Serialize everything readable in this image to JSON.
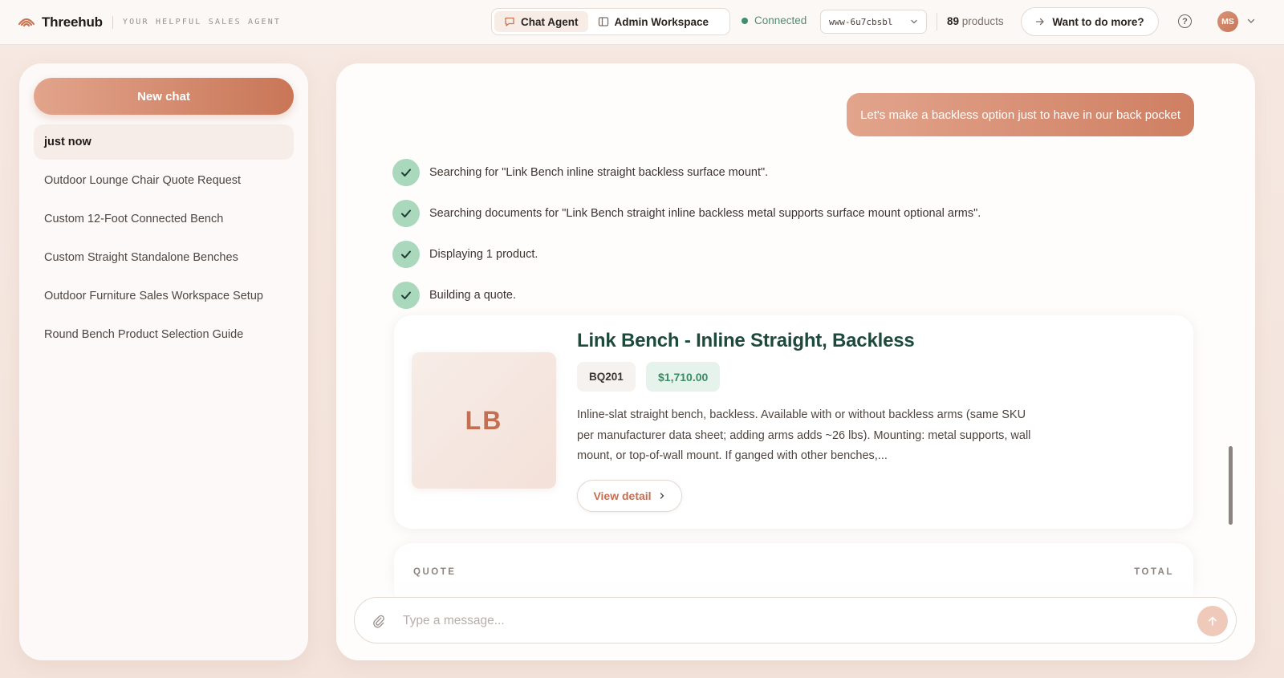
{
  "header": {
    "app_name": "Threehub",
    "tagline": "YOUR HELPFUL SALES AGENT",
    "modes": [
      {
        "label": "Chat Agent",
        "icon": "chat-bubble-icon",
        "active": true
      },
      {
        "label": "Admin Workspace",
        "icon": "sidebar-panel-icon",
        "active": false
      }
    ],
    "connection_status": "Connected",
    "environment": "www-6u7cbsbl",
    "product_count": "89",
    "product_count_suffix": "products",
    "more_button": "Want to do more?",
    "help_glyph": "?",
    "user_initials": "MS",
    "accent_color": "#c97657"
  },
  "sidebar": {
    "new_chat_label": "New chat",
    "chats": [
      {
        "label": "just now",
        "active": true
      },
      {
        "label": "Outdoor Lounge Chair Quote Request",
        "active": false
      },
      {
        "label": "Custom 12-Foot Connected Bench",
        "active": false
      },
      {
        "label": "Custom Straight Standalone Benches",
        "active": false
      },
      {
        "label": "Outdoor Furniture Sales Workspace Setup",
        "active": false
      },
      {
        "label": "Round Bench Product Selection Guide",
        "active": false
      }
    ]
  },
  "conversation": {
    "user_message": "Let's make a backless option just to have in our back pocket",
    "steps": [
      {
        "text": "Searching for \"Link Bench inline straight backless surface mount\".",
        "status": "done"
      },
      {
        "text": "Searching documents for \"Link Bench straight inline backless metal supports surface mount optional arms\".",
        "status": "done"
      },
      {
        "text": "Displaying 1 product.",
        "status": "done"
      },
      {
        "text": "Building a quote.",
        "status": "done"
      }
    ],
    "product": {
      "initials": "LB",
      "title": "Link Bench - Inline Straight, Backless",
      "sku": "BQ201",
      "price": "$1,710.00",
      "description": "Inline-slat straight bench, backless. Available with or without backless arms (same SKU per manufacturer data sheet; adding arms adds ~26 lbs). Mounting: metal supports, wall mount, or top-of-wall mount. If ganged with other benches,...",
      "view_detail_label": "View detail"
    },
    "quote": {
      "quote_label": "QUOTE",
      "total_label": "TOTAL"
    }
  },
  "composer": {
    "placeholder": "Type a message..."
  }
}
